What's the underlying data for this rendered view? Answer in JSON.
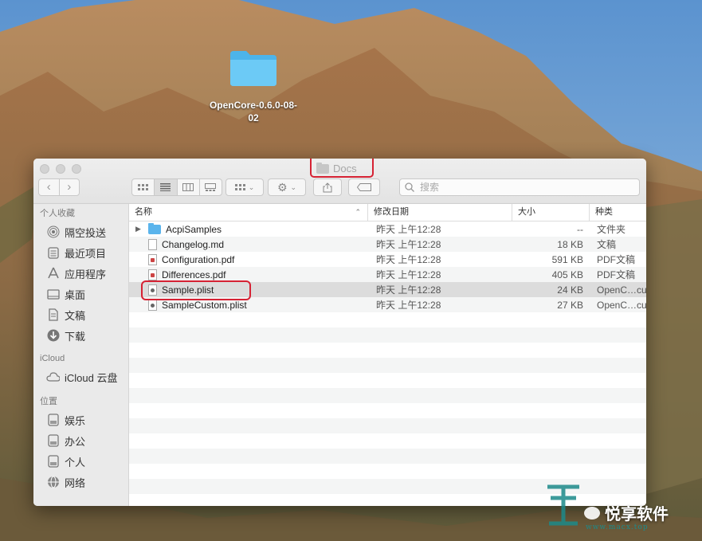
{
  "desktop": {
    "folder_label": "OpenCore-0.6.0-08-02"
  },
  "window": {
    "title": "Docs",
    "search_placeholder": "搜索"
  },
  "sidebar": {
    "favorites_header": "个人收藏",
    "favorites": [
      {
        "label": "隔空投送",
        "icon": "airdrop-icon"
      },
      {
        "label": "最近项目",
        "icon": "recents-icon"
      },
      {
        "label": "应用程序",
        "icon": "applications-icon"
      },
      {
        "label": "桌面",
        "icon": "desktop-icon"
      },
      {
        "label": "文稿",
        "icon": "documents-icon"
      },
      {
        "label": "下载",
        "icon": "downloads-icon"
      }
    ],
    "icloud_header": "iCloud",
    "icloud": [
      {
        "label": "iCloud 云盘",
        "icon": "cloud-icon"
      }
    ],
    "locations_header": "位置",
    "locations": [
      {
        "label": "娱乐",
        "icon": "disk-icon"
      },
      {
        "label": "办公",
        "icon": "disk-icon"
      },
      {
        "label": "个人",
        "icon": "disk-icon"
      },
      {
        "label": "网络",
        "icon": "network-icon"
      }
    ]
  },
  "columns": {
    "name": "名称",
    "date": "修改日期",
    "size": "大小",
    "kind": "种类"
  },
  "files": [
    {
      "name": "AcpiSamples",
      "date": "昨天 上午12:28",
      "size": "--",
      "kind": "文件夹",
      "type": "folder"
    },
    {
      "name": "Changelog.md",
      "date": "昨天 上午12:28",
      "size": "18 KB",
      "kind": "文稿",
      "type": "doc"
    },
    {
      "name": "Configuration.pdf",
      "date": "昨天 上午12:28",
      "size": "591 KB",
      "kind": "PDF文稿",
      "type": "pdf"
    },
    {
      "name": "Differences.pdf",
      "date": "昨天 上午12:28",
      "size": "405 KB",
      "kind": "PDF文稿",
      "type": "pdf"
    },
    {
      "name": "Sample.plist",
      "date": "昨天 上午12:28",
      "size": "24 KB",
      "kind": "OpenC…cument",
      "type": "plist",
      "selected": true
    },
    {
      "name": "SampleCustom.plist",
      "date": "昨天 上午12:28",
      "size": "27 KB",
      "kind": "OpenC…cument",
      "type": "plist"
    }
  ],
  "watermark": {
    "text": "悦享软件",
    "url": "www.macx.top"
  }
}
